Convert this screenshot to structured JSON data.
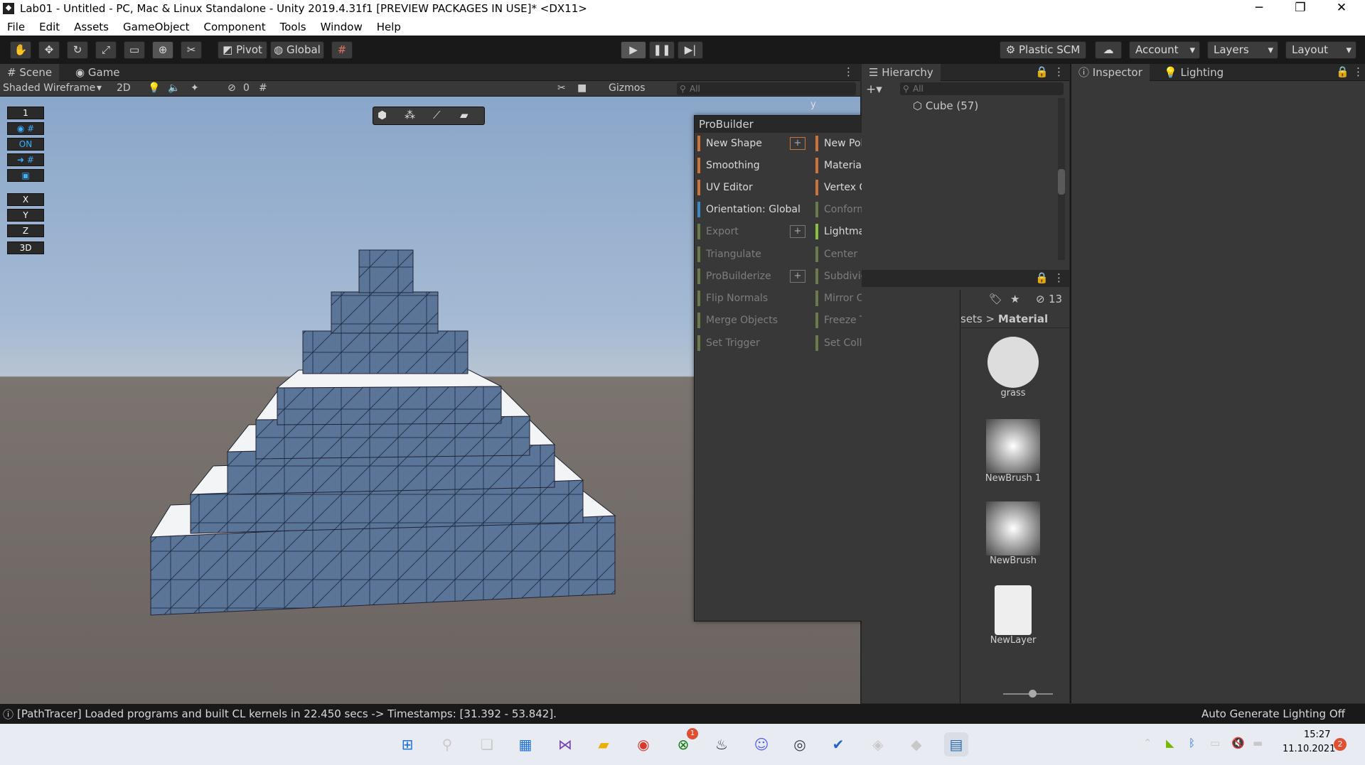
{
  "window": {
    "title": "Lab01 - Untitled - PC, Mac & Linux Standalone - Unity 2019.4.31f1 [PREVIEW PACKAGES IN USE]* <DX11>",
    "minimize": "─",
    "restore": "❐",
    "close": "✕"
  },
  "menu": [
    "File",
    "Edit",
    "Assets",
    "GameObject",
    "Component",
    "Tools",
    "Window",
    "Help"
  ],
  "toolbar": {
    "pivot": "Pivot",
    "global": "Global",
    "plastic": "Plastic SCM",
    "account": "Account",
    "layers": "Layers",
    "layout": "Layout"
  },
  "scene": {
    "tab_scene": "Scene",
    "tab_game": "Game",
    "shading": "Shaded Wireframe",
    "mode2d": "2D",
    "hidden_count": "0",
    "gizmos": "Gizmos",
    "search_placeholder": "All",
    "view_label": "y"
  },
  "overlay": {
    "num": "1",
    "on": "ON",
    "x": "X",
    "y": "Y",
    "z": "Z",
    "d3": "3D"
  },
  "probuilder": {
    "title": "ProBuilder",
    "left": [
      "New Shape",
      "Smoothing",
      "UV Editor",
      "Orientation: Global",
      "Export",
      "Triangulate",
      "ProBuilderize",
      "Flip Normals",
      "Merge Objects",
      "Set Trigger"
    ],
    "right": [
      "New Poly Shape",
      "Material Editor",
      "Vertex Colors",
      "Conform Normals",
      "Lightmap UVs",
      "Center Pivot",
      "Subdivide Object",
      "Mirror Objects",
      "Freeze Transform",
      "Set Collider"
    ]
  },
  "hierarchy": {
    "title": "Hierarchy",
    "search_placeholder": "All",
    "item": "Cube (57)"
  },
  "project": {
    "hidden_count": "13",
    "breadcrumb_prev": "sets",
    "breadcrumb_sep": ">",
    "breadcrumb_cur": "Material",
    "assets": [
      "grass",
      "NewBrush 1",
      "NewBrush",
      "NewLayer"
    ]
  },
  "inspector": {
    "tab_inspector": "Inspector",
    "tab_lighting": "Lighting"
  },
  "status": {
    "message": "[PathTracer] Loaded programs and built CL kernels in 22.450 secs -> Timestamps: [31.392 - 53.842].",
    "lighting": "Auto Generate Lighting Off"
  },
  "taskbar": {
    "time": "15:27",
    "date": "11.10.2021",
    "notif": "2",
    "xbox_badge": "1"
  }
}
